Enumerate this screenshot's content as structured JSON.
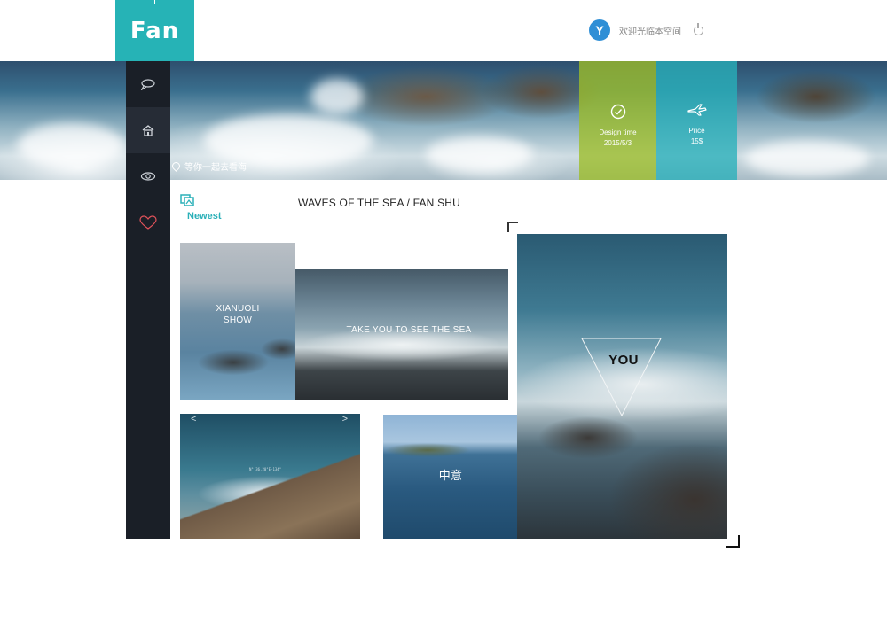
{
  "header": {
    "logo_text": "Fan",
    "avatar_letter": "Y",
    "welcome_text": "欢迎光临本空间"
  },
  "banner": {
    "location_text": "等你一起去看海",
    "design_card": {
      "label": "Design time",
      "value": "2015/5/3"
    },
    "price_card": {
      "label": "Price",
      "value": "15$"
    }
  },
  "sidebar": {
    "items": [
      {
        "icon": "chat-bubble-icon"
      },
      {
        "icon": "home-icon"
      },
      {
        "icon": "eye-icon"
      },
      {
        "icon": "heart-icon"
      }
    ]
  },
  "main": {
    "newest_label": "Newest",
    "section_title": "WAVES OF THE SEA / FAN SHU",
    "tiles": {
      "t1_caption_line1": "XIANUOLI",
      "t1_caption_line2": "SHOW",
      "t2_caption": "TAKE YOU TO SEE THE SEA",
      "t3_prev": "<",
      "t3_next": ">",
      "t3_coord": "N° 36.20°E-134°",
      "t4_caption": "中意",
      "t5_caption": "YOU"
    }
  },
  "colors": {
    "accent": "#26b3b6",
    "design_card": "#9ebe28",
    "price_card": "#28b0ba",
    "sidebar": "#1a1f27"
  }
}
